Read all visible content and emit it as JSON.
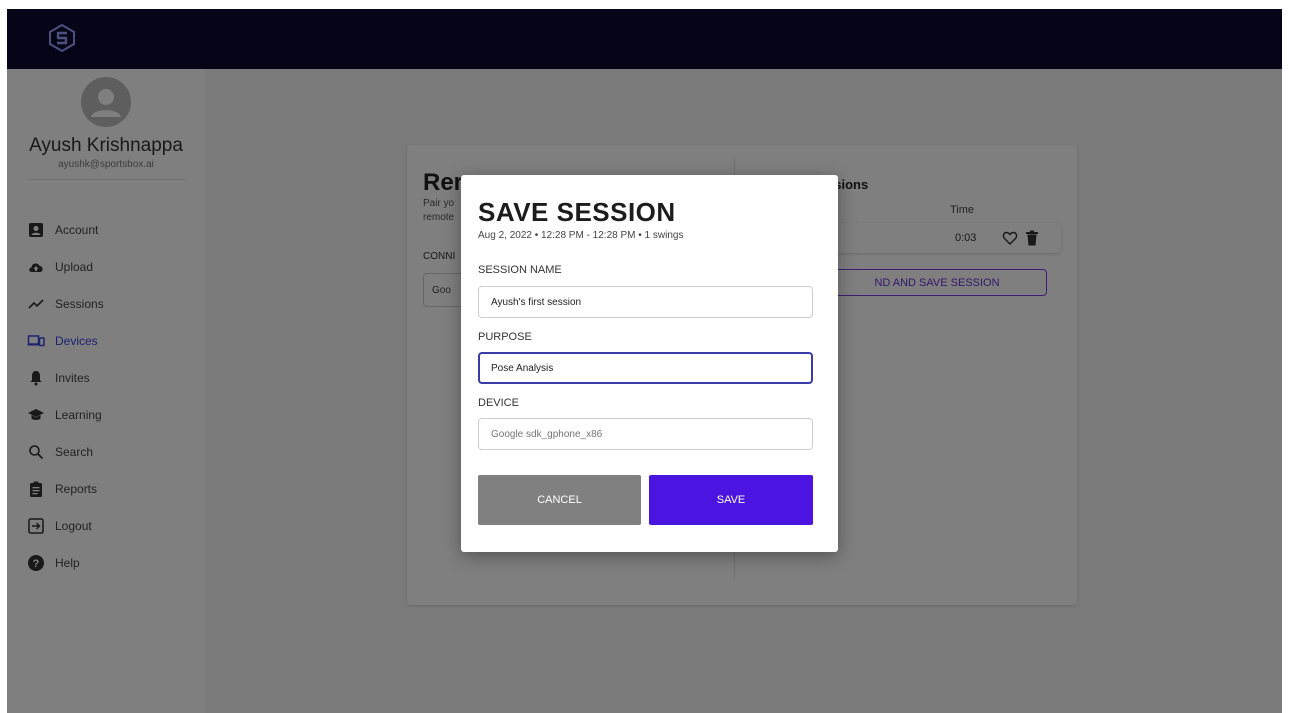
{
  "app": {
    "logo_icon": "sportsbox-logo-icon",
    "topbar_color": "#0a0a2e",
    "accent_color": "#4b14e0"
  },
  "user": {
    "name": "Ayush Krishnappa",
    "email": "ayushk@sportsbox.ai",
    "avatar_icon": "person-icon"
  },
  "sidebar": {
    "items": [
      {
        "label": "Account",
        "icon": "account-box-icon",
        "active": false
      },
      {
        "label": "Upload",
        "icon": "cloud-upload-icon",
        "active": false
      },
      {
        "label": "Sessions",
        "icon": "trend-line-icon",
        "active": false
      },
      {
        "label": "Devices",
        "icon": "devices-icon",
        "active": true
      },
      {
        "label": "Invites",
        "icon": "bell-icon",
        "active": false
      },
      {
        "label": "Learning",
        "icon": "graduation-cap-icon",
        "active": false
      },
      {
        "label": "Search",
        "icon": "search-icon",
        "active": false
      },
      {
        "label": "Reports",
        "icon": "clipboard-icon",
        "active": false
      },
      {
        "label": "Logout",
        "icon": "logout-icon",
        "active": false
      },
      {
        "label": "Help",
        "icon": "help-icon",
        "active": false
      }
    ]
  },
  "remote_card": {
    "title": "Rer",
    "desc_line1": "Pair yo",
    "desc_line2": "remote",
    "connect_label": "CONNI",
    "device_select_value": "Goo"
  },
  "sessions_panel": {
    "title": "ssions",
    "time_header": "Time",
    "rows": [
      {
        "time": "0:03",
        "icons": [
          "heart-outline-icon",
          "trash-icon"
        ]
      }
    ],
    "end_save_label": "ND AND SAVE SESSION"
  },
  "modal": {
    "title": "SAVE SESSION",
    "subtitle": "Aug 2, 2022 • 12:28 PM - 12:28 PM • 1 swings",
    "session_name_label": "SESSION NAME",
    "session_name_value": "Ayush's first session",
    "purpose_label": "PURPOSE",
    "purpose_value": "Pose Analysis",
    "device_label": "DEVICE",
    "device_placeholder": "Google sdk_gphone_x86",
    "cancel_label": "CANCEL",
    "save_label": "SAVE"
  }
}
